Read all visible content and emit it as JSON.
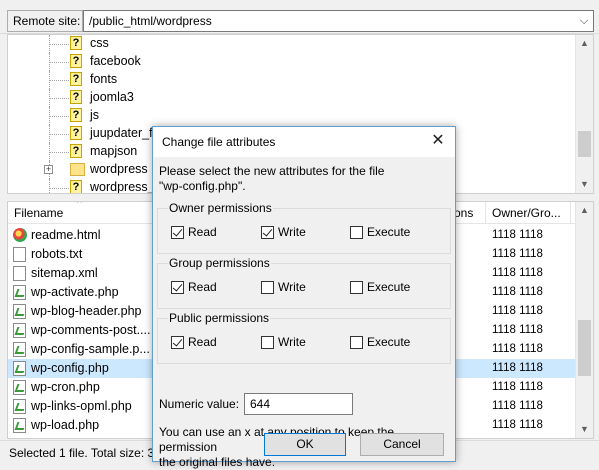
{
  "remote_site": {
    "label": "Remote site:",
    "path": "/public_html/wordpress"
  },
  "tree": {
    "items": [
      {
        "label": "css",
        "icon": "question-folder-icon"
      },
      {
        "label": "facebook",
        "icon": "question-folder-icon"
      },
      {
        "label": "fonts",
        "icon": "question-folder-icon"
      },
      {
        "label": "joomla3",
        "icon": "question-folder-icon"
      },
      {
        "label": "js",
        "icon": "question-folder-icon"
      },
      {
        "label": "juupdater_fi",
        "icon": "question-folder-icon"
      },
      {
        "label": "mapjson",
        "icon": "question-folder-icon"
      },
      {
        "label": "wordpress",
        "icon": "folder-icon"
      },
      {
        "label": "wordpress_t",
        "icon": "question-folder-icon"
      }
    ]
  },
  "files": {
    "columns": {
      "filename": "Filename",
      "permissions": "ons",
      "owner": "Owner/Gro..."
    },
    "rows": [
      {
        "name": "readme.html",
        "owner": "1118 1118",
        "icon": "html"
      },
      {
        "name": "robots.txt",
        "owner": "1118 1118",
        "icon": "txt"
      },
      {
        "name": "sitemap.xml",
        "owner": "1118 1118",
        "icon": "txt"
      },
      {
        "name": "wp-activate.php",
        "owner": "1118 1118",
        "icon": "php"
      },
      {
        "name": "wp-blog-header.php",
        "owner": "1118 1118",
        "icon": "php"
      },
      {
        "name": "wp-comments-post....",
        "owner": "1118 1118",
        "icon": "php"
      },
      {
        "name": "wp-config-sample.p...",
        "owner": "1118 1118",
        "icon": "php"
      },
      {
        "name": "wp-config.php",
        "owner": "1118 1118",
        "icon": "php"
      },
      {
        "name": "wp-cron.php",
        "owner": "1118 1118",
        "icon": "php"
      },
      {
        "name": "wp-links-opml.php",
        "owner": "1118 1118",
        "icon": "php"
      },
      {
        "name": "wp-load.php",
        "owner": "1118 1118",
        "icon": "php"
      }
    ]
  },
  "status": {
    "text": "Selected 1 file. Total size: 3,"
  },
  "dialog": {
    "title": "Change file attributes",
    "close": "✕",
    "message_line1": "Please select the new attributes for the file",
    "message_line2": "\"wp-config.php\".",
    "groups": [
      {
        "title": "Owner permissions",
        "read": "Read",
        "write": "Write",
        "execute": "Execute",
        "read_checked": true,
        "write_checked": true,
        "execute_checked": false
      },
      {
        "title": "Group permissions",
        "read": "Read",
        "write": "Write",
        "execute": "Execute",
        "read_checked": true,
        "write_checked": false,
        "execute_checked": false
      },
      {
        "title": "Public permissions",
        "read": "Read",
        "write": "Write",
        "execute": "Execute",
        "read_checked": true,
        "write_checked": false,
        "execute_checked": false
      }
    ],
    "numeric_label": "Numeric value:",
    "numeric_value": "644",
    "hint_line1": "You can use an x at any position to keep the permission",
    "hint_line2": "the original files have.",
    "ok": "OK",
    "cancel": "Cancel"
  }
}
